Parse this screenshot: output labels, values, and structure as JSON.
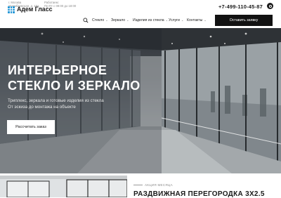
{
  "header": {
    "address": "г. Москва",
    "address_line2": "Илимбаевская, д. 10а",
    "hours_label": "Работаем:",
    "hours": "Пн-Пт с 09:00 до 18:00",
    "phone": "+7-499-110-45-87",
    "whatsapp_icon": "whatsapp-icon"
  },
  "logo": {
    "name": "Адем Гласс",
    "tagline": "СТЕКЛЯННЫЕ РЕШЕНИЯ",
    "accent": "#2b9ad8"
  },
  "nav": {
    "search_icon": "search-icon",
    "items": [
      {
        "label": "Стекло"
      },
      {
        "label": "Зеркало"
      },
      {
        "label": "Изделия из стекла"
      },
      {
        "label": "Услуги"
      },
      {
        "label": "Контакты"
      }
    ],
    "cta": "Оставить заявку"
  },
  "hero": {
    "title_line1": "ИНТЕРЬЕРНОЕ",
    "title_line2": "СТЕКЛО И ЗЕРКАЛО",
    "subtitle_line1": "Триплекс, зеркала и готовые изделия из стекла",
    "subtitle_line2": "От эскиза до монтажа на объекте",
    "button": "Рассчитать заказ"
  },
  "promo": {
    "label": "АКЦИЯ МЕСЯЦА",
    "title": "РАЗДВИЖНАЯ ПЕРЕГОРОДКА 3Х2.5"
  },
  "colors": {
    "dark": "#121212",
    "accent": "#2b9ad8"
  }
}
